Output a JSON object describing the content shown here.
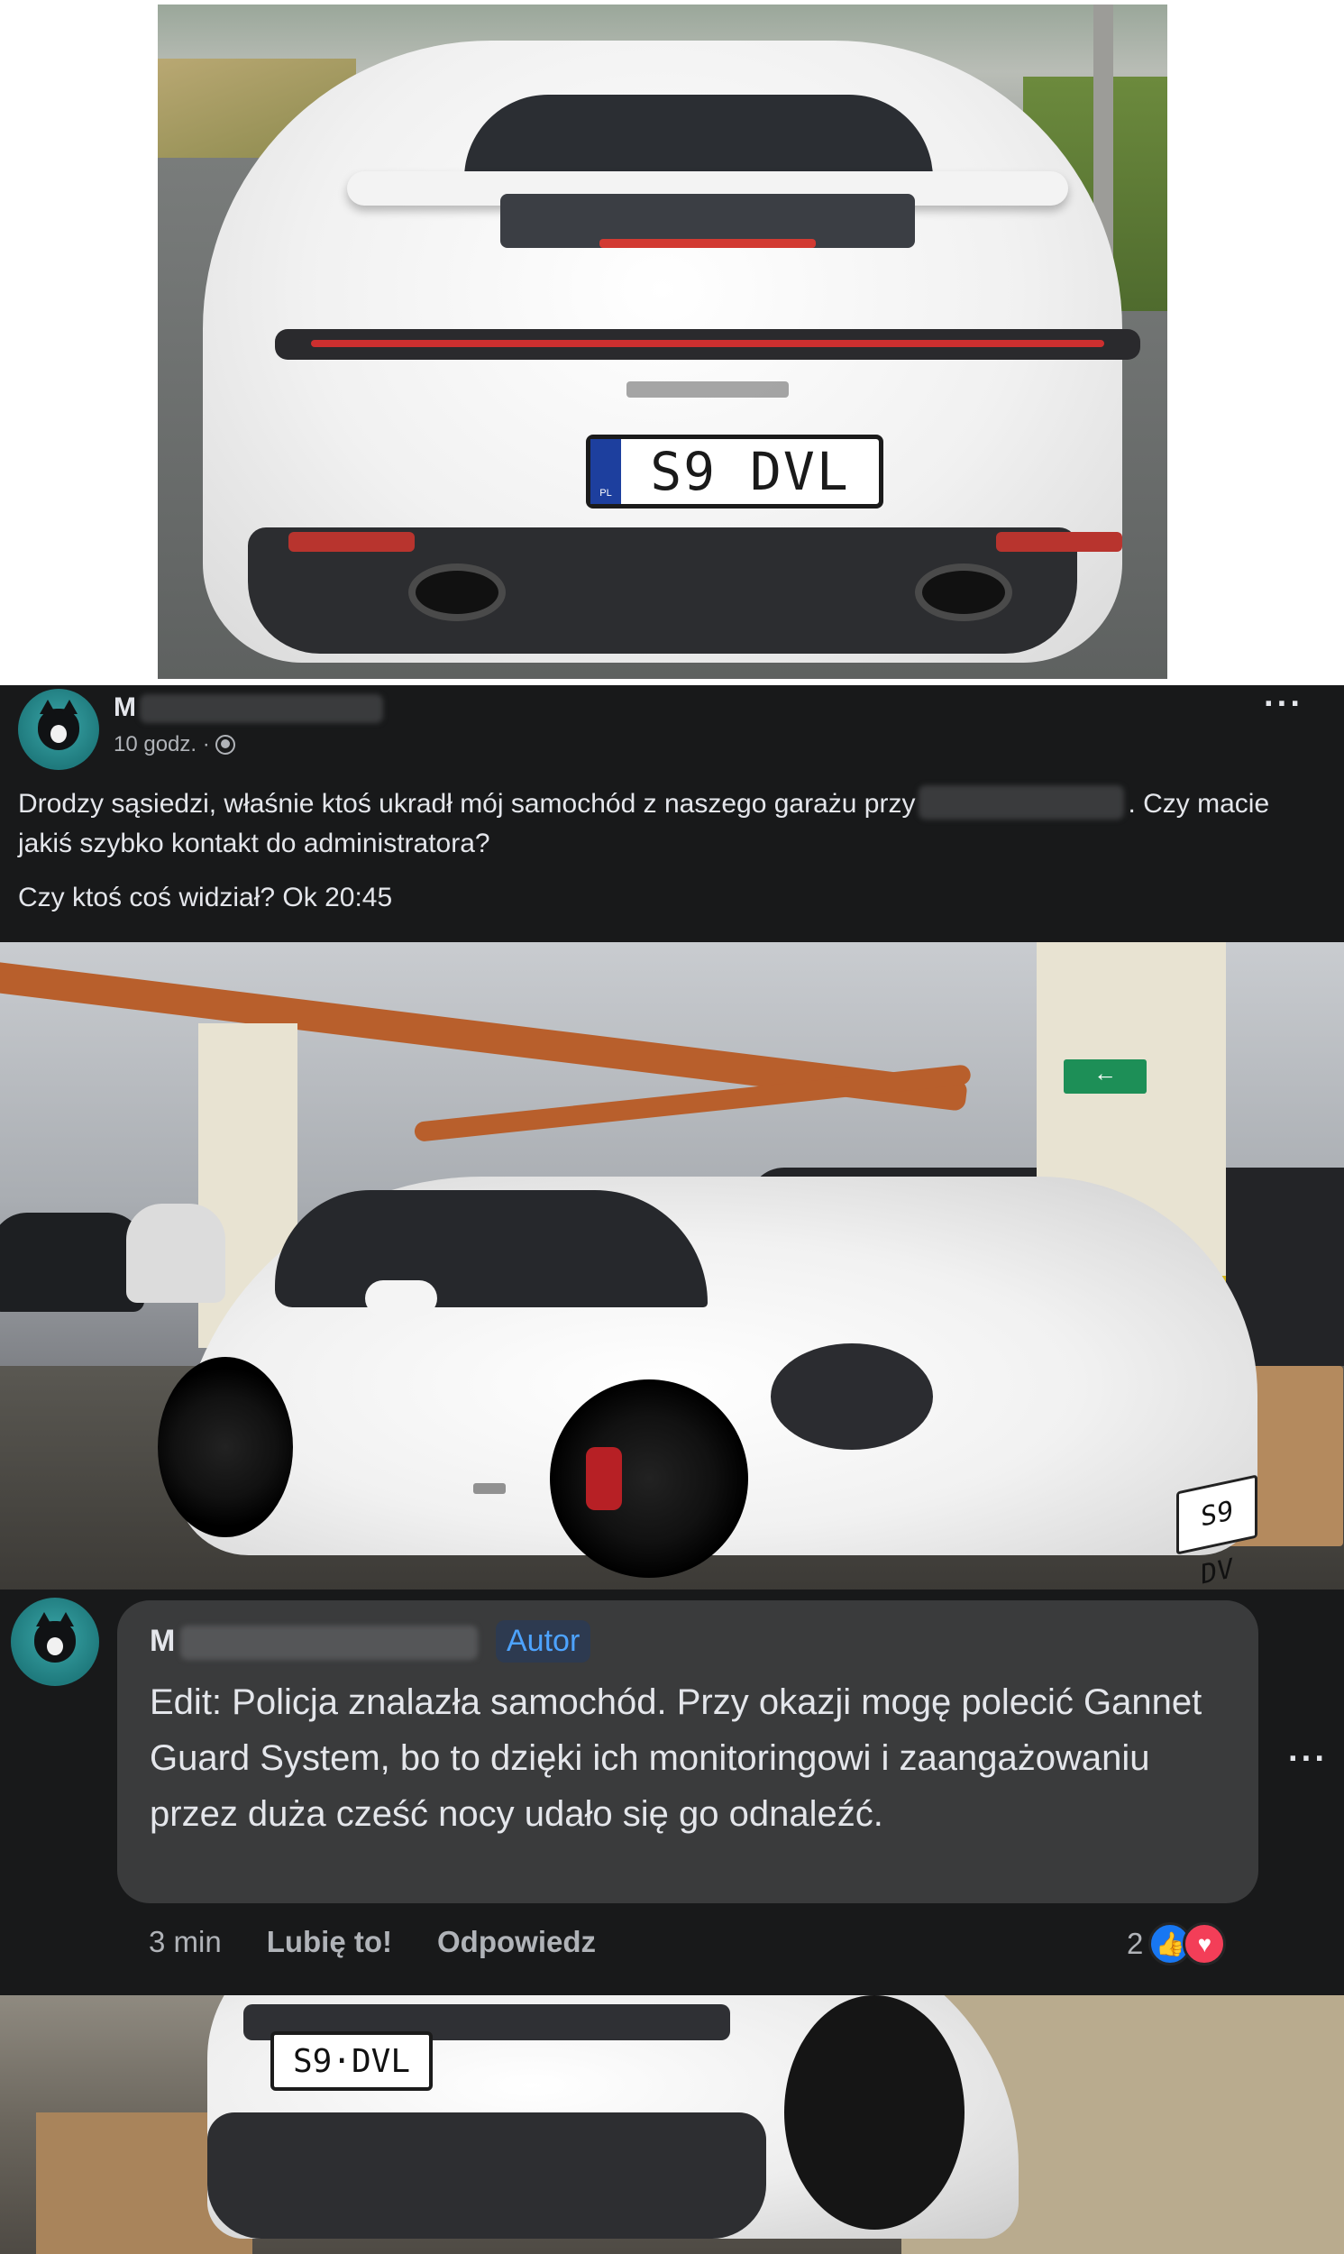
{
  "top_photo": {
    "plate": "S9 DVL",
    "plate_country": "PL"
  },
  "post": {
    "author_initial": "M",
    "time": "10 godz. ·",
    "text_line1_before": "Drodzy sąsiedzi, właśnie ktoś ukradł mój samochód z naszego garażu przy",
    "text_line1_after": ". Czy macie jakiś szybko kontakt do administratora?",
    "text_line2": "Czy ktoś coś widział? Ok 20:45",
    "more": "···"
  },
  "garage_photo": {
    "plate": "S9 DV",
    "exit_sign": "←"
  },
  "comment": {
    "author_initial": "M",
    "badge": "Autor",
    "text": "Edit: Policja znalazła samochód. Przy okazji mogę polecić Gannet Guard System, bo to dzięki ich monitoringowi i zaangażowaniu przez duża cześć nocy udało się go odnaleźć.",
    "time": "3 min",
    "like_action": "Lubię to!",
    "reply_action": "Odpowiedz",
    "reaction_count": "2",
    "more": "···"
  },
  "bottom_photo": {
    "plate": "S9·DVL"
  },
  "colors": {
    "post_bg": "#18191a",
    "bubble_bg": "#3a3b3c",
    "text_primary": "#e4e6eb",
    "text_secondary": "#b0b3b8",
    "author_badge": "#4da3ff",
    "like": "#1877f2",
    "love": "#f33e58"
  }
}
